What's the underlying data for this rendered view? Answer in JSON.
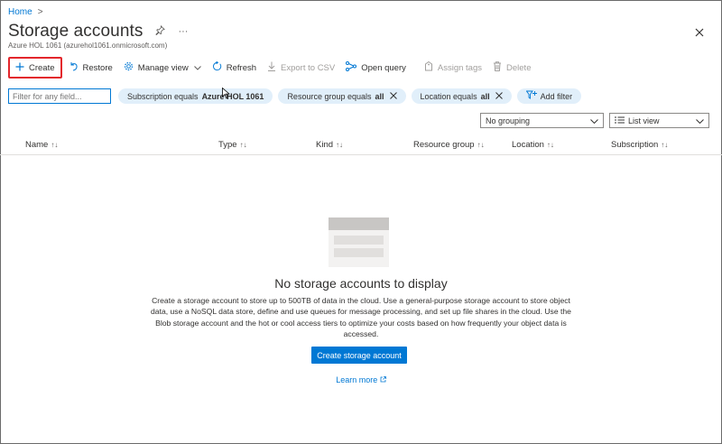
{
  "breadcrumb": {
    "home": "Home",
    "separator": ">"
  },
  "header": {
    "title": "Storage accounts",
    "subtitle": "Azure HOL 1061 (azurehol1061.onmicrosoft.com)",
    "pin_icon": "pin-icon",
    "more_icon": "ellipsis-icon",
    "close_icon": "close-icon"
  },
  "toolbar": {
    "create": "Create",
    "restore": "Restore",
    "manage_view": "Manage view",
    "refresh": "Refresh",
    "export_csv": "Export to CSV",
    "open_query": "Open query",
    "assign_tags": "Assign tags",
    "delete": "Delete"
  },
  "filters": {
    "search_placeholder": "Filter for any field...",
    "subscription_prefix": "Subscription equals",
    "subscription_value": "Azure HOL 1061",
    "resource_group_prefix": "Resource group equals",
    "resource_group_value": "all",
    "location_prefix": "Location equals",
    "location_value": "all",
    "add_filter": "Add filter"
  },
  "view": {
    "grouping": "No grouping",
    "view_mode": "List view"
  },
  "table": {
    "columns": [
      "Name",
      "Type",
      "Kind",
      "Resource group",
      "Location",
      "Subscription"
    ]
  },
  "empty_state": {
    "title": "No storage accounts to display",
    "description": "Create a storage account to store up to 500TB of data in the cloud. Use a general-purpose storage account to store object data, use a NoSQL data store, define and use queues for message processing, and set up file shares in the cloud. Use the Blob storage account and the hot or cool access tiers to optimize your costs based on how frequently your object data is accessed.",
    "button": "Create storage account",
    "learn_more": "Learn more"
  },
  "colors": {
    "accent": "#0078d4",
    "highlight_border": "#e3262c",
    "pill_bg": "#e1effa"
  }
}
